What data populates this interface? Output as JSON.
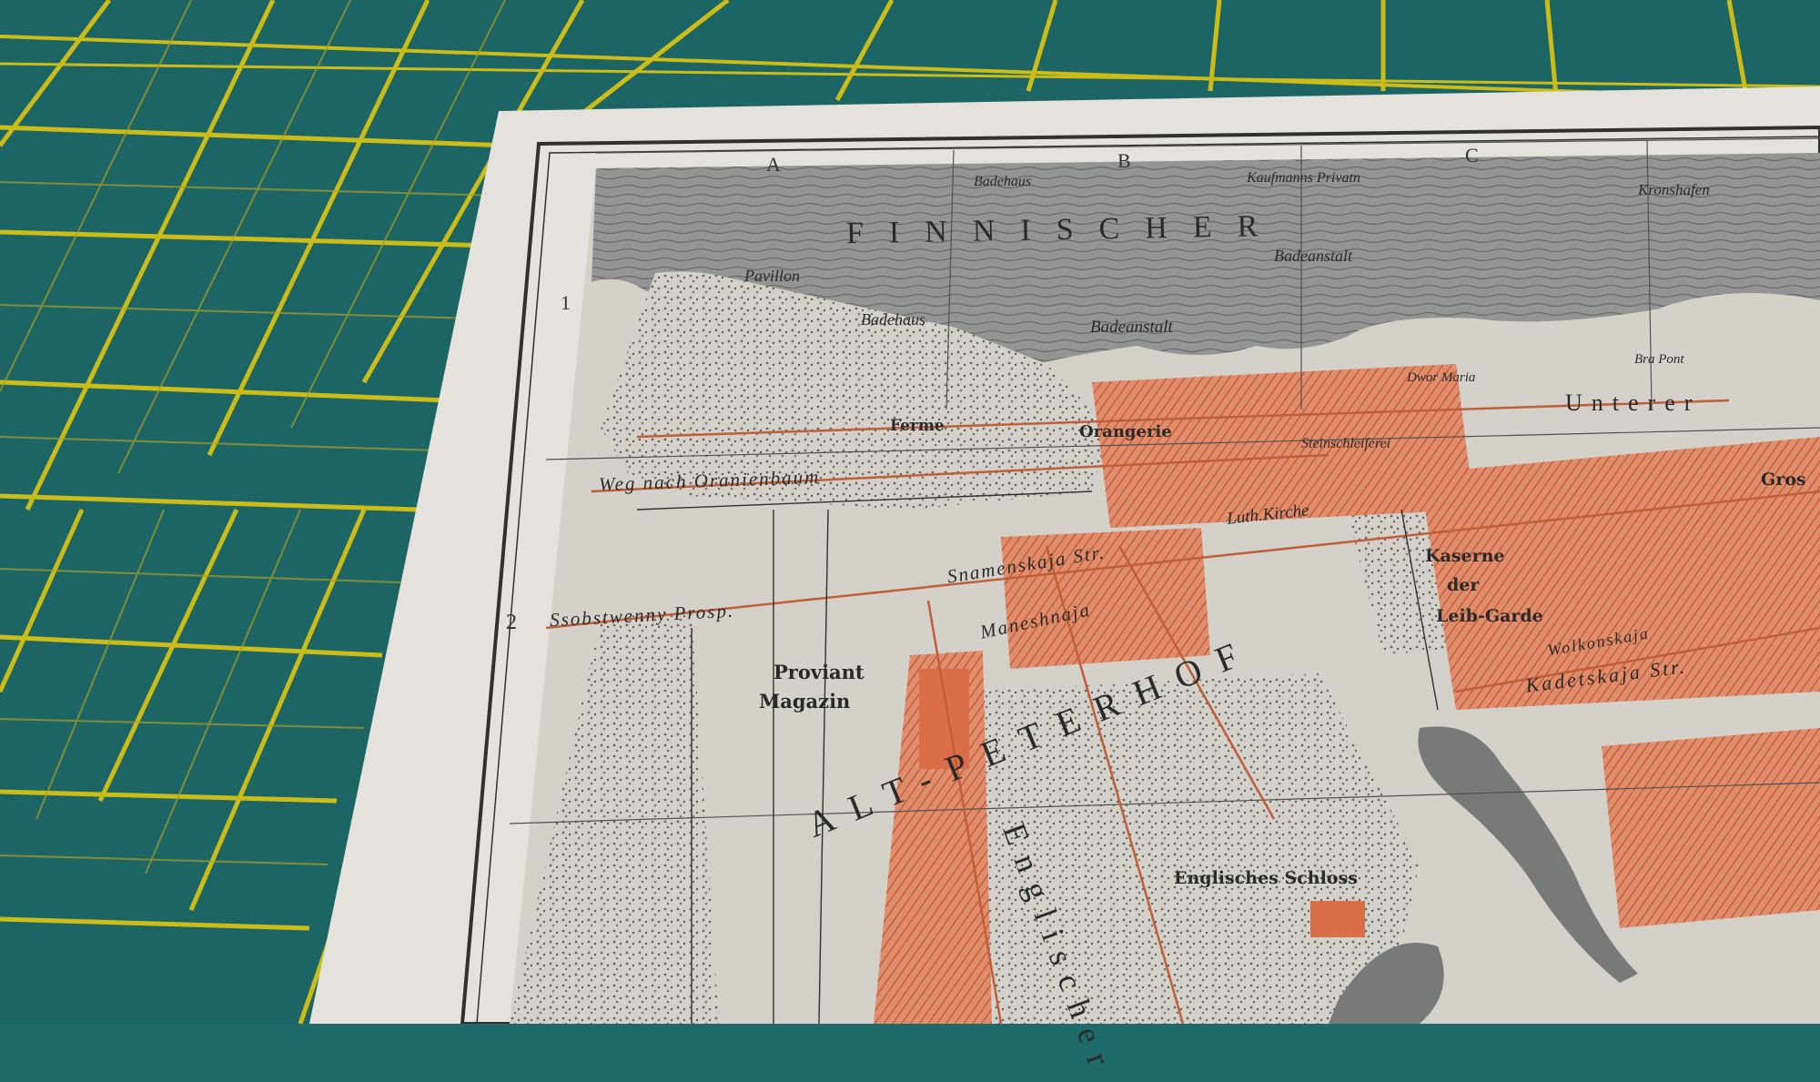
{
  "map": {
    "grid_columns": [
      "A",
      "B",
      "C"
    ],
    "grid_rows": [
      "1",
      "2"
    ],
    "sea_label": "FINNISCHER",
    "district_label": "ALT-PETERHOF",
    "park_label": "Englischer",
    "labels": {
      "pavillon": "Pavillon",
      "badehaus_1": "Badehaus",
      "badehaus_2": "Badehaus",
      "badeanstalt_1": "Badeanstalt",
      "badeanstalt_2": "Badeanstalt",
      "kaufmannshaus": "Kaufmanns Privatn",
      "kronshafen": "Kronshafen",
      "ferme": "Ferme",
      "orangerie": "Orangerie",
      "steinschleiferei": "Steinschleiferei",
      "dwor_maria": "Dwor Maria",
      "bra_pont": "Bra Pont",
      "unterer": "Unterer",
      "weg_nach_oranienbaum": "Weg nach Oranienbaum",
      "snamenskaja": "Snamenskaja Str.",
      "ssobstwenny": "Ssobstwenny Prosp.",
      "luth_kirche": "Luth.Kirche",
      "kaserne_1": "Kaserne",
      "kaserne_2": "der",
      "kaserne_3": "Leib-Garde",
      "proviant_1": "Proviant",
      "proviant_2": "Magazin",
      "kadetskaja": "Kadetskaja Str.",
      "wolkonskaja": "Wolkonskaja",
      "englisches_schloss": "Englisches Schloss",
      "maneshnaja": "Maneshnaja",
      "gros": "Gros"
    }
  },
  "colors": {
    "cutting_mat": "#1f6a6a",
    "mat_grid": "#d4c419",
    "paper": "#efece6",
    "map_paper": "#e2e0da",
    "water": "#8c8d8d",
    "buildings": "#e2734c",
    "ink": "#2a2a2a"
  }
}
